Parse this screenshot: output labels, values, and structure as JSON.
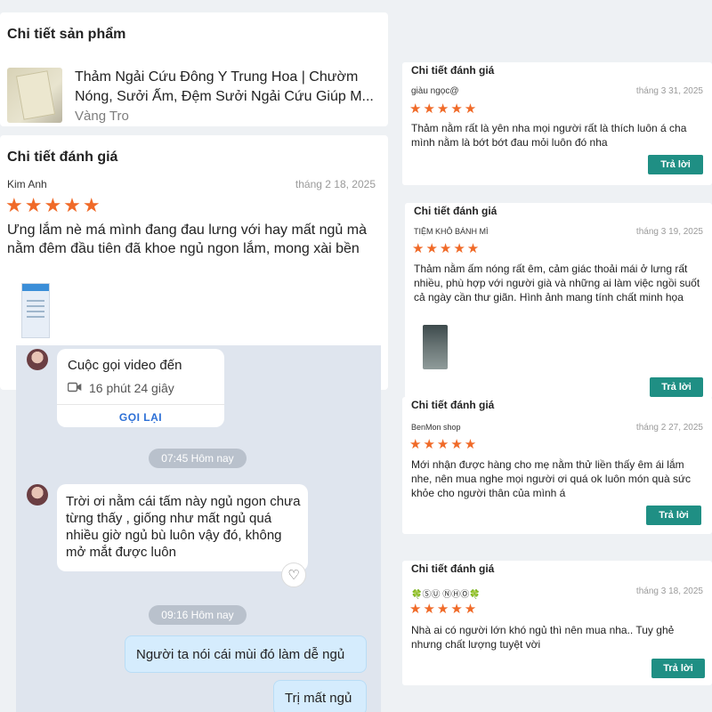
{
  "product_section": {
    "title": "Chi tiết sản phẩm",
    "product_name": "Thảm Ngải Cứu Đông Y Trung Hoa | Chườm Nóng, Sưởi Ấm, Đệm Sưởi Ngải Cứu Giúp M...",
    "variant": "Vàng Tro"
  },
  "main_review": {
    "title": "Chi tiết đánh giá",
    "reviewer": "Kim Anh",
    "date": "tháng 2 18, 2025",
    "stars": "★★★★★",
    "rating": 5,
    "text": "Ưng lắm nè má mình đang đau lưng với hay mất ngủ mà nằm đêm đầu tiên đã khoe ngủ ngon lắm, mong xài bền"
  },
  "chat": {
    "call_title": "Cuộc gọi video đến",
    "call_duration": "16 phút 24 giây",
    "call_back": "GỌI LẠI",
    "time1": "07:45 Hôm nay",
    "incoming_message": "Trời ơi nằm cái tấm này ngủ ngon chưa từng thấy , giống như mất ngủ quá nhiều giờ ngủ bù luôn vậy đó, không mở mắt được luôn",
    "time2": "09:16 Hôm nay",
    "outgoing_1": "Người ta nói cái mùi đó làm dễ ngủ",
    "outgoing_2": "Trị mất ngủ"
  },
  "right_reviews": [
    {
      "title": "Chi tiết đánh giá",
      "reviewer": "giàu ngọc@",
      "date": "tháng 3 31, 2025",
      "stars": "★★★★★",
      "rating": 5,
      "text": "Thảm nằm rất là yên nha mọi người rất là thích luôn á cha mình nằm là bớt bớt đau mỏi luôn đó nha",
      "reply": "Trả lời"
    },
    {
      "title": "Chi tiết đánh giá",
      "reviewer": "TIỆM KHÔ BÁNH MÌ",
      "date": "tháng 3 19, 2025",
      "stars": "★★★★★",
      "rating": 5,
      "text": "Thảm nằm ấm nóng rất êm, cảm giác thoải mái ở lưng rất nhiều, phù hợp với người già và những ai làm việc ngồi suốt cả ngày cần thư giãn. Hình ảnh mang tính chất minh họa",
      "reply": "Trả lời"
    },
    {
      "title": "Chi tiết đánh giá",
      "reviewer": "BenMon shop",
      "date": "tháng 2 27, 2025",
      "stars": "★★★★★",
      "rating": 5,
      "text": "Mới nhận được hàng cho mẹ nằm thử liền thấy êm ái lắm nhe, nên mua nghe mọi người ơi quá ok luôn món quà sức khỏe cho người thân của mình á",
      "reply": "Trả lời"
    },
    {
      "title": "Chi tiết đánh giá",
      "reviewer": "🍀ⓈⓊ ⓃⒽⓄ🍀",
      "date": "tháng 3 18, 2025",
      "stars": "★★★★★",
      "rating": 5,
      "text": "Nhà ai có người lớn khó ngủ thì nên mua nha.. Tuy ghẻ nhưng chất lượng tuyệt vời",
      "reply": "Trả lời"
    }
  ],
  "colors": {
    "star": "#f06a28",
    "reply_button": "#1f8f84",
    "chat_background": "#dfe5ee",
    "outgoing_bubble": "#d5ecfd",
    "call_back_link": "#2c6fd6"
  },
  "icons": [
    "video-camera-icon",
    "heart-icon",
    "star-icon"
  ]
}
